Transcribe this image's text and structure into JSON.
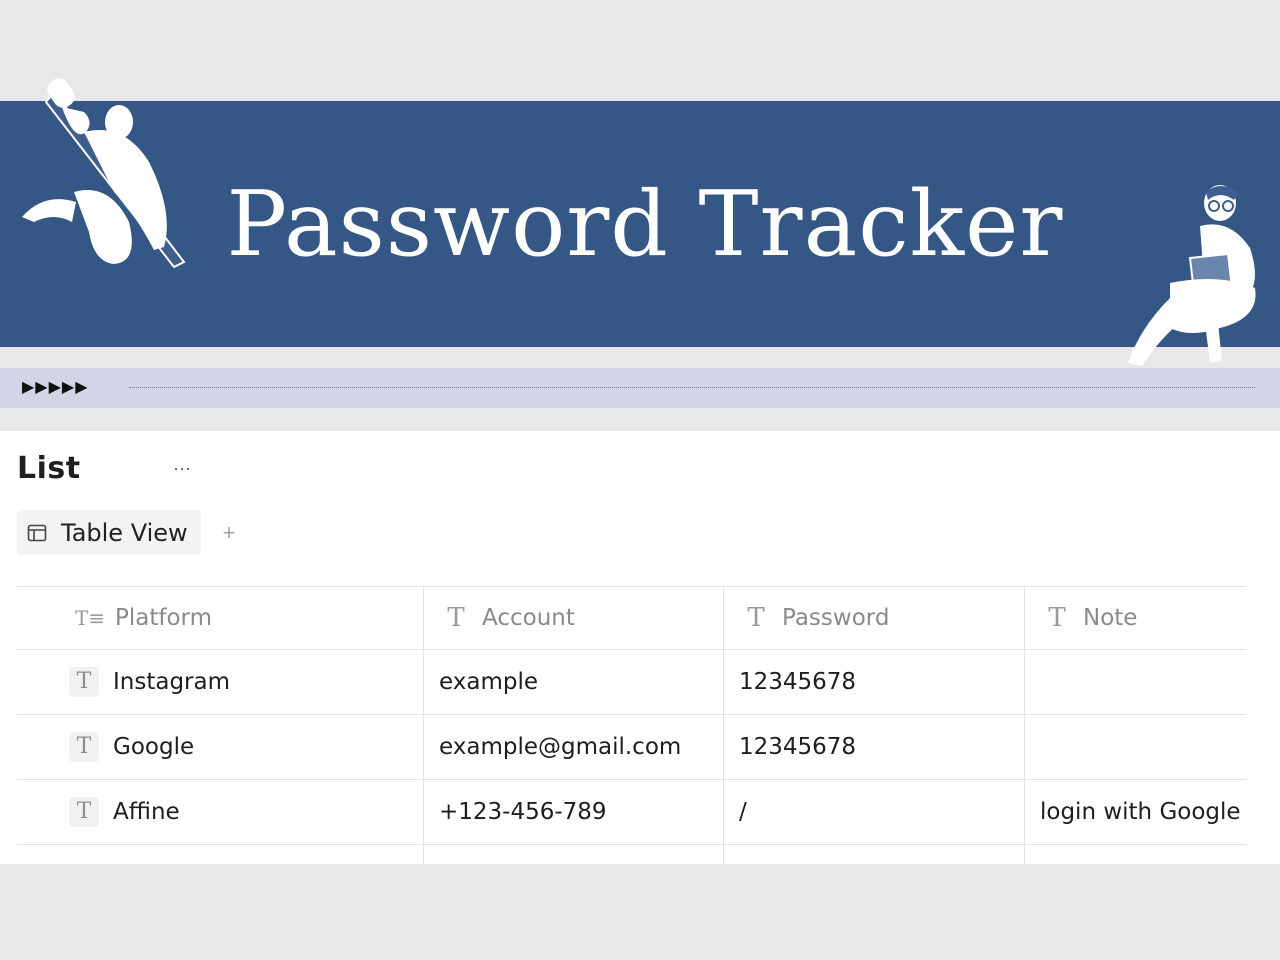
{
  "banner": {
    "title": "Password Tracker",
    "background": "#355785"
  },
  "divider": {
    "arrows": "▶▶▶▶▶"
  },
  "list": {
    "title": "List",
    "more_label": "···",
    "views": [
      {
        "label": "Table View",
        "icon": "table-view-icon"
      }
    ],
    "add_view_label": "+"
  },
  "table": {
    "columns": [
      {
        "label": "Platform",
        "icon": "title-text-icon"
      },
      {
        "label": "Account",
        "icon": "text-icon"
      },
      {
        "label": "Password",
        "icon": "text-icon"
      },
      {
        "label": "Note",
        "icon": "text-icon"
      }
    ],
    "rows": [
      {
        "platform": "Instagram",
        "account": "example",
        "password": "12345678",
        "note": ""
      },
      {
        "platform": "Google",
        "account": "example@gmail.com",
        "password": "12345678",
        "note": ""
      },
      {
        "platform": "Affine",
        "account": "+123-456-789",
        "password": "/",
        "note": "login with Google"
      }
    ]
  }
}
